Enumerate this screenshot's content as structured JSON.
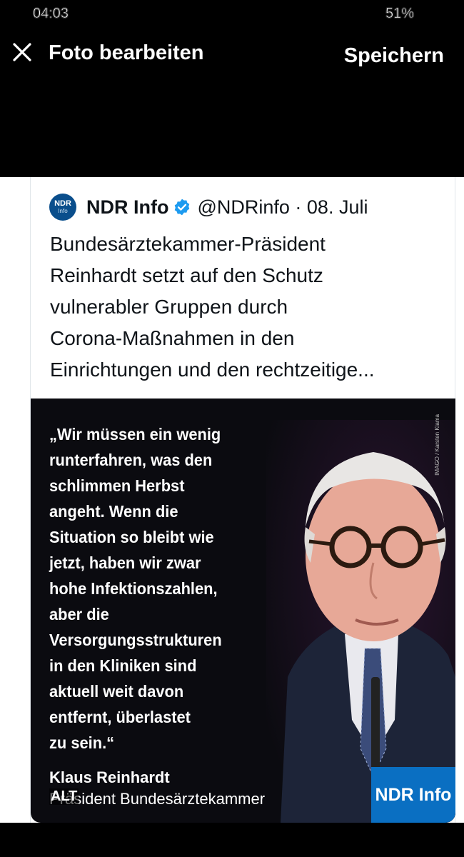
{
  "status": {
    "time": "04:03",
    "battery": "51%"
  },
  "topbar": {
    "title": "Foto bearbeiten",
    "save_label": "Speichern",
    "close_icon": "close-icon"
  },
  "tweet": {
    "avatar_line1": "NDR",
    "avatar_line2": "Info",
    "display_name": "NDR Info",
    "handle_date": "@NDRinfo · 08. Juli",
    "text_lines": [
      "Bundesärztekammer-Präsident",
      "Reinhardt setzt auf den Schutz",
      "vulnerabler Gruppen durch",
      "Corona-Maßnahmen in den",
      "Einrichtungen und den rechtzeitige..."
    ],
    "verified_color": "#1d9bf0"
  },
  "media": {
    "quote_lines": [
      "„Wir müssen ein wenig",
      "runterfahren, was den",
      "schlimmen Herbst",
      "angeht. Wenn die",
      "Situation so bleibt wie",
      "jetzt, haben wir zwar",
      "hohe Infektionszahlen,",
      "aber die",
      "Versorgungsstrukturen",
      "in den Kliniken sind",
      "aktuell weit davon",
      "entfernt, überlastet",
      "zu sein.“"
    ],
    "attribution_name": "Klaus Reinhardt",
    "attribution_role": "Präsident Bundesärztekammer",
    "alt_badge": "ALT",
    "credit": "IMAGO / Karsten Klama",
    "logo_text": "NDR Info",
    "logo_color": "#0a6fc2"
  }
}
